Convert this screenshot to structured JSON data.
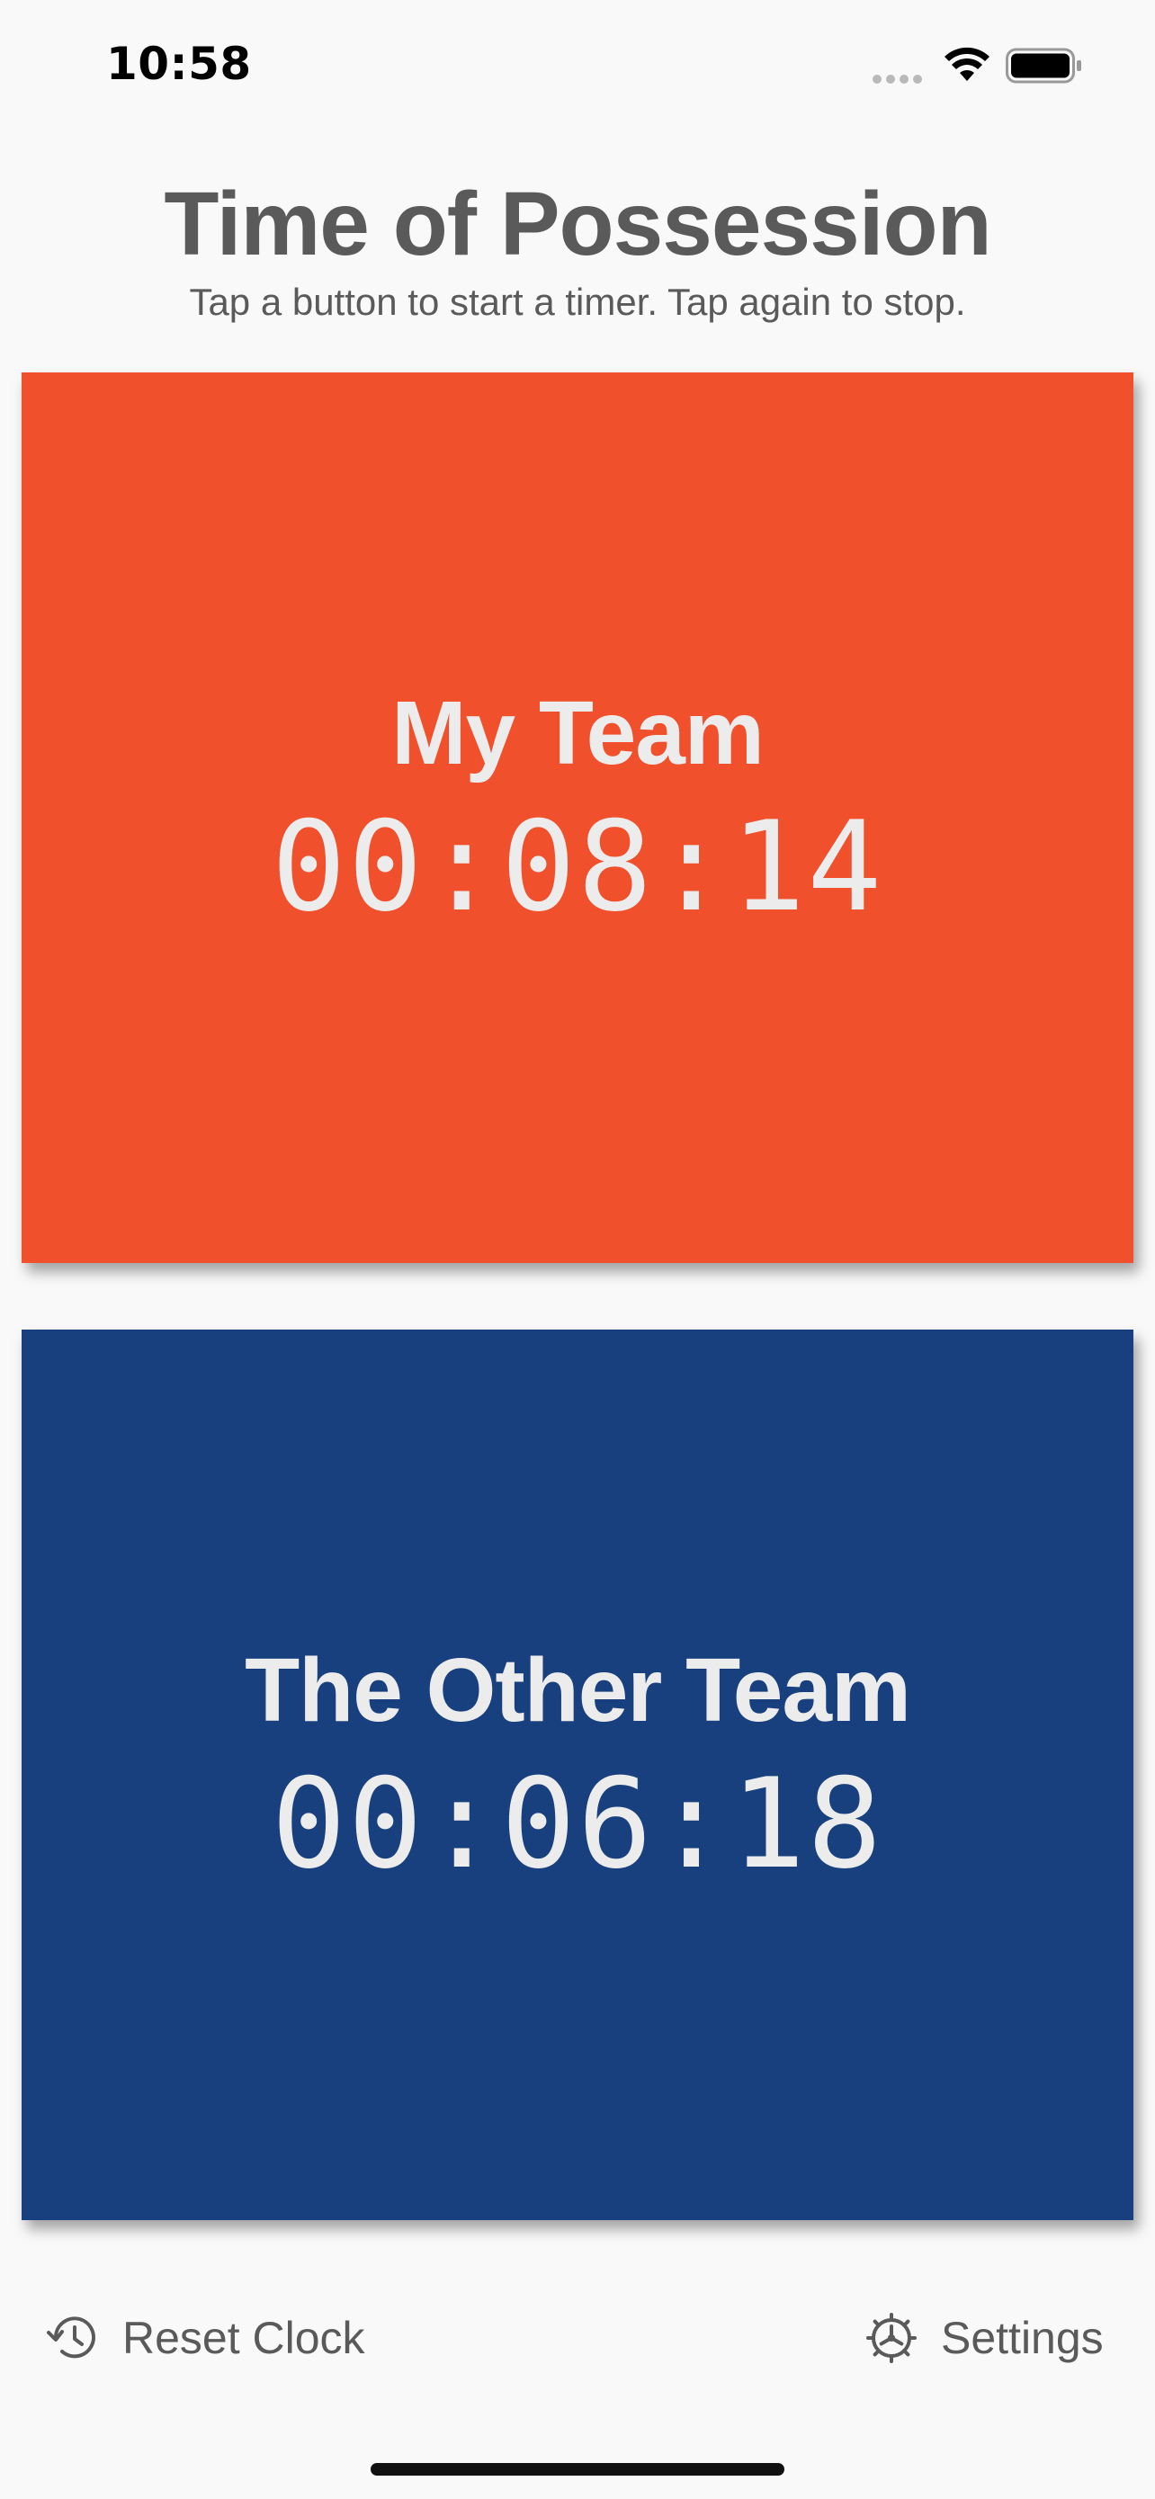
{
  "status_bar": {
    "time": "10:58",
    "icons": [
      "signal-icon",
      "wifi-icon",
      "battery-icon"
    ]
  },
  "header": {
    "title": "Time of Possession",
    "subtitle": "Tap a button to start a timer. Tap again to stop."
  },
  "teams": [
    {
      "name": "My Team",
      "timer": "00:08:14",
      "color": "#f0502b"
    },
    {
      "name": "The Other Team",
      "timer": "00:06:18",
      "color": "#18407e"
    }
  ],
  "toolbar": {
    "reset_label": "Reset Clock",
    "reset_icon": "clock-history-icon",
    "settings_label": "Settings",
    "settings_icon": "gear-icon"
  },
  "colors": {
    "background": "#f9f9f9",
    "text": "#5a5a5a",
    "card_text": "#ececec"
  }
}
